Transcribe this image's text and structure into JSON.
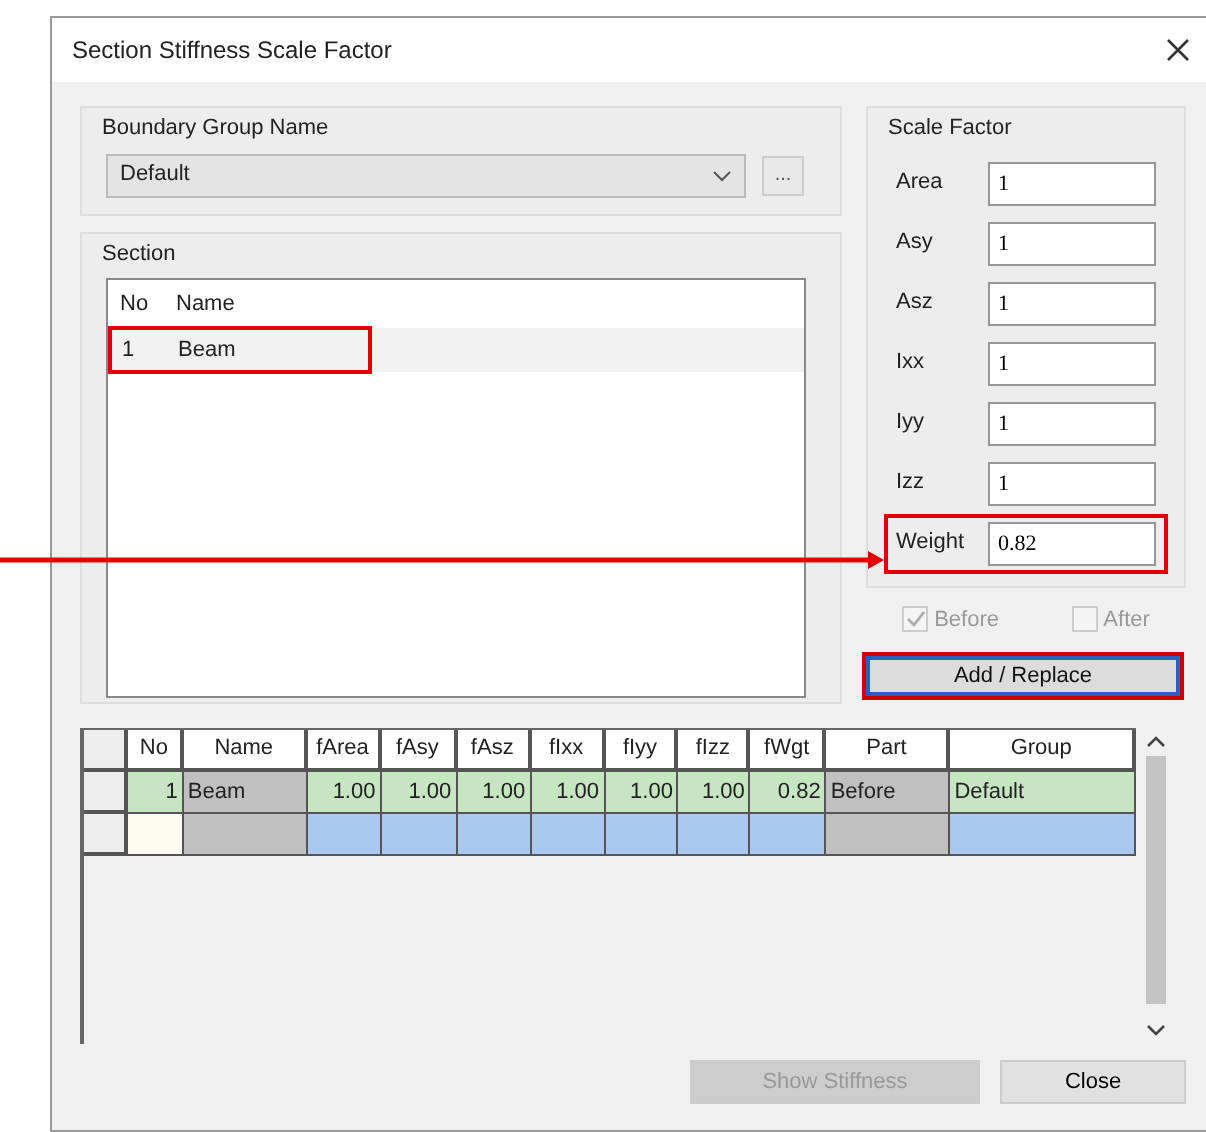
{
  "window": {
    "title": "Section Stiffness Scale Factor"
  },
  "boundary_group": {
    "label": "Boundary Group Name",
    "value": "Default",
    "browse": "..."
  },
  "section": {
    "label": "Section",
    "columns": [
      "No",
      "Name"
    ],
    "rows": [
      {
        "no": "1",
        "name": "Beam",
        "selected": true,
        "highlighted": true
      }
    ]
  },
  "scale_factor": {
    "label": "Scale Factor",
    "fields": [
      {
        "label": "Area",
        "value": "1",
        "highlighted": false
      },
      {
        "label": "Asy",
        "value": "1",
        "highlighted": false
      },
      {
        "label": "Asz",
        "value": "1",
        "highlighted": false
      },
      {
        "label": "Ixx",
        "value": "1",
        "highlighted": false
      },
      {
        "label": "Iyy",
        "value": "1",
        "highlighted": false
      },
      {
        "label": "Izz",
        "value": "1",
        "highlighted": false
      },
      {
        "label": "Weight",
        "value": "0.82",
        "highlighted": true
      }
    ]
  },
  "arrow_to_highlight": true,
  "part_options": [
    {
      "label": "Before",
      "checked": true,
      "disabled": true
    },
    {
      "label": "After",
      "checked": false,
      "disabled": true
    }
  ],
  "add_button": {
    "label": "Add / Replace",
    "highlighted": true
  },
  "table": {
    "columns": [
      {
        "label": "No",
        "kind": "index"
      },
      {
        "label": "Name",
        "kind": "readonly"
      },
      {
        "label": "fArea",
        "kind": "value"
      },
      {
        "label": "fAsy",
        "kind": "value"
      },
      {
        "label": "fAsz",
        "kind": "value"
      },
      {
        "label": "fIxx",
        "kind": "value"
      },
      {
        "label": "fIyy",
        "kind": "value"
      },
      {
        "label": "fIzz",
        "kind": "value"
      },
      {
        "label": "fWgt",
        "kind": "value"
      },
      {
        "label": "Part",
        "kind": "readonly"
      },
      {
        "label": "Group",
        "kind": "text"
      }
    ],
    "rows": [
      {
        "kind": "data",
        "cells": [
          "1",
          "Beam",
          "1.00",
          "1.00",
          "1.00",
          "1.00",
          "1.00",
          "1.00",
          "0.82",
          "Before",
          "Default"
        ]
      },
      {
        "kind": "new"
      }
    ]
  },
  "buttons": [
    {
      "label": "Show Stiffness",
      "disabled": true
    },
    {
      "label": "Close",
      "disabled": false
    }
  ]
}
